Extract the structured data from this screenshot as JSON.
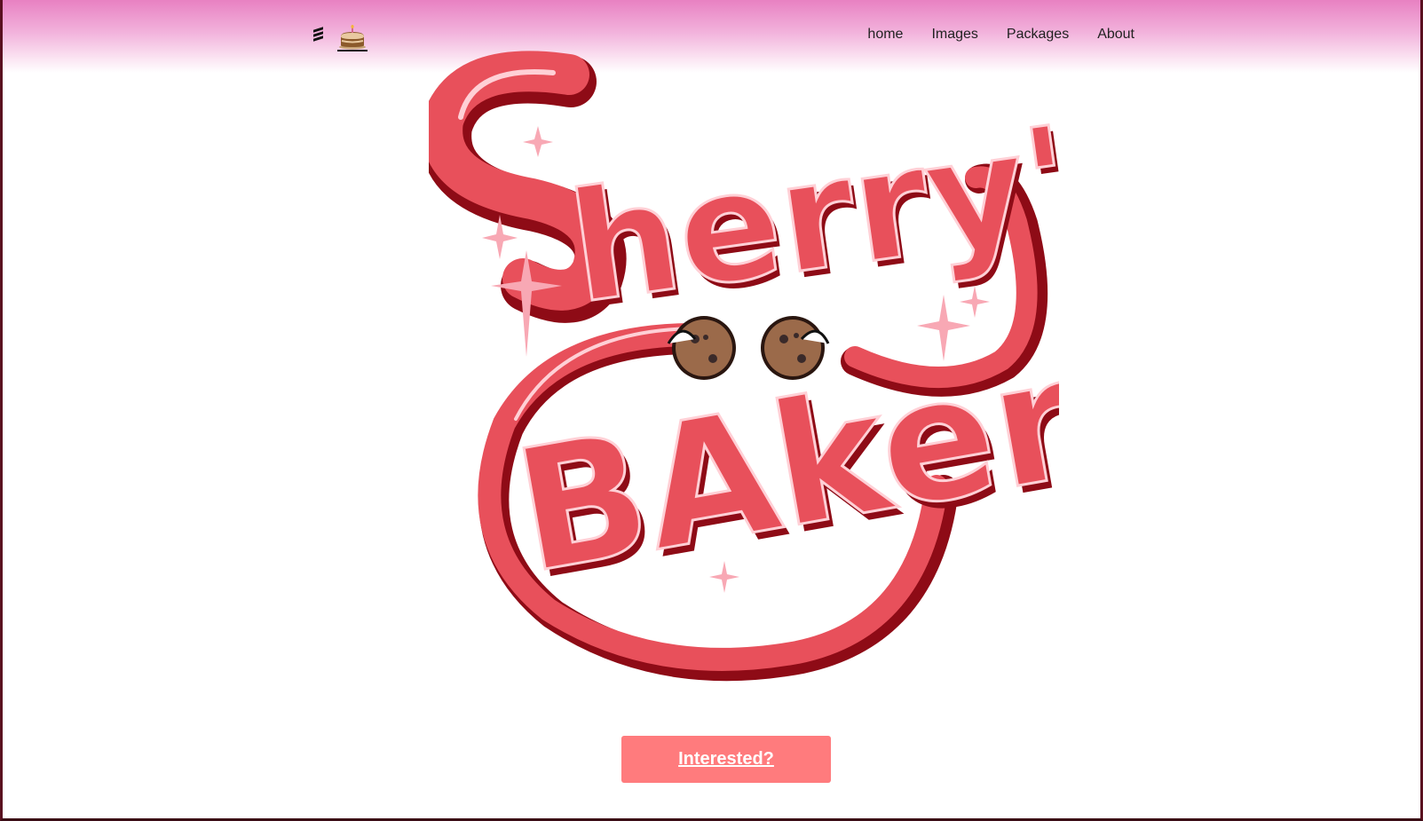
{
  "header": {
    "menu_icon": "hamburger-menu-icon",
    "logo_icon": "cake-icon",
    "nav": [
      {
        "label": "home"
      },
      {
        "label": "Images"
      },
      {
        "label": "Packages"
      },
      {
        "label": "About"
      }
    ]
  },
  "hero": {
    "logo_text_line1": "Sherry'nd",
    "logo_text_line2": "BAkery",
    "logo_colors": {
      "primary": "#e8505b",
      "shadow": "#8e0b16",
      "sparkle": "#f8a8b4"
    }
  },
  "cta": {
    "label": "Interested?",
    "color": "#ff7b7d"
  }
}
